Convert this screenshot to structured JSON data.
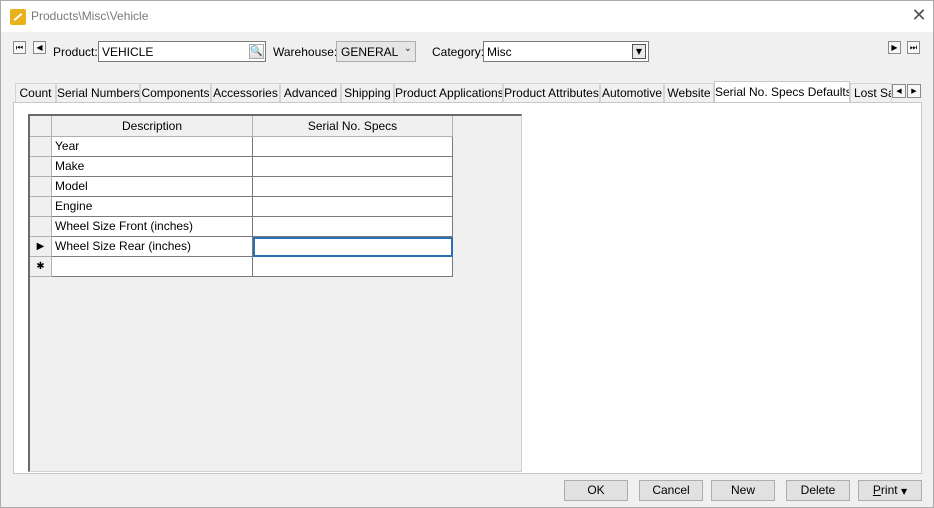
{
  "window": {
    "title": "Products\\Misc\\Vehicle",
    "close_glyph": "✕"
  },
  "toolbar": {
    "first_glyph": "⏮",
    "prev_glyph": "◀",
    "next_glyph": "▶",
    "last_glyph": "⏭",
    "product_label": "Product:",
    "product_value": "VEHICLE",
    "warehouse_label": "Warehouse:",
    "warehouse_value": "GENERAL",
    "category_label": "Category:",
    "category_value": "Misc"
  },
  "tabs": [
    {
      "label": "Count"
    },
    {
      "label": "Serial Numbers"
    },
    {
      "label": "Components"
    },
    {
      "label": "Accessories"
    },
    {
      "label": "Advanced"
    },
    {
      "label": "Shipping"
    },
    {
      "label": "Product Applications"
    },
    {
      "label": "Product Attributes"
    },
    {
      "label": "Automotive"
    },
    {
      "label": "Website"
    },
    {
      "label": "Serial No. Specs Defaults"
    },
    {
      "label": "Lost Sa"
    }
  ],
  "active_tab": "Serial No. Specs Defaults",
  "grid": {
    "columns": [
      "Description",
      "Serial No. Specs"
    ],
    "rows": [
      {
        "indicator": "",
        "description": "Year",
        "spec": ""
      },
      {
        "indicator": "",
        "description": "Make",
        "spec": ""
      },
      {
        "indicator": "",
        "description": "Model",
        "spec": ""
      },
      {
        "indicator": "",
        "description": "Engine",
        "spec": ""
      },
      {
        "indicator": "",
        "description": "Wheel Size Front (inches)",
        "spec": ""
      },
      {
        "indicator": "▶",
        "description": "Wheel Size Rear (inches)",
        "spec": ""
      },
      {
        "indicator": "✱",
        "description": "",
        "spec": ""
      }
    ]
  },
  "buttons": {
    "ok": "OK",
    "cancel": "Cancel",
    "new": "New",
    "delete": "Delete",
    "print_first": "P",
    "print_rest": "rint",
    "print_caret": "▼"
  },
  "colors": {
    "focus_border": "#2d6fb5",
    "app_icon": "#e8b21a"
  }
}
